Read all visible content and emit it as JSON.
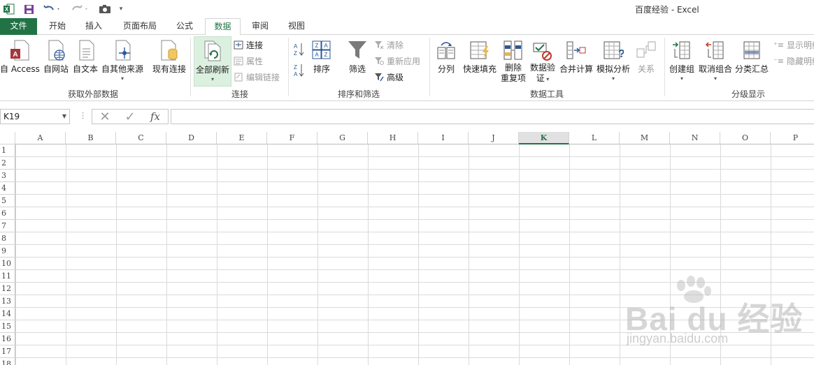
{
  "window": {
    "title": "百度经验 - Excel"
  },
  "tabs": {
    "file": "文件",
    "items": [
      "开始",
      "插入",
      "页面布局",
      "公式",
      "数据",
      "审阅",
      "视图"
    ],
    "active": "数据"
  },
  "ribbon": {
    "get_external": {
      "access": "自 Access",
      "web": "自网站",
      "text": "自文本",
      "other": "自其他来源",
      "existing": "现有连接",
      "group_label": "获取外部数据"
    },
    "connections": {
      "refresh_all": "全部刷新",
      "connections": "连接",
      "properties": "属性",
      "edit_links": "编辑链接",
      "group_label": "连接"
    },
    "sort_filter": {
      "sort": "排序",
      "filter": "筛选",
      "clear": "清除",
      "reapply": "重新应用",
      "advanced": "高级",
      "group_label": "排序和筛选"
    },
    "data_tools": {
      "split": "分列",
      "flash_fill": "快速填充",
      "remove_dup_1": "删除",
      "remove_dup_2": "重复项",
      "validation_1": "数据验",
      "validation_2": "证",
      "consolidate": "合并计算",
      "what_if": "模拟分析",
      "relations": "关系",
      "group_label": "数据工具"
    },
    "outline": {
      "group": "创建组",
      "ungroup": "取消组合",
      "subtotal": "分类汇总",
      "show_detail": "显示明细",
      "hide_detail": "隐藏明细",
      "group_label": "分级显示"
    }
  },
  "formula_bar": {
    "name_box": "K19",
    "fx": "fx",
    "formula": ""
  },
  "sheet": {
    "columns": [
      "A",
      "B",
      "C",
      "D",
      "E",
      "F",
      "G",
      "H",
      "I",
      "J",
      "K",
      "L",
      "M",
      "N",
      "O",
      "P"
    ],
    "active_column": "K",
    "rows": [
      "1",
      "2",
      "3",
      "4",
      "5",
      "6",
      "7",
      "8",
      "9",
      "10",
      "11",
      "12",
      "13",
      "14",
      "15",
      "16",
      "17",
      "18"
    ]
  },
  "watermark": {
    "main": "Bai du 经验",
    "sub": "jingyan.baidu.com"
  },
  "colors": {
    "accent": "#217346",
    "gridline": "#dadada"
  }
}
